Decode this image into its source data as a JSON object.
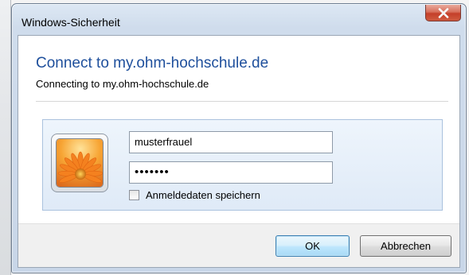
{
  "window": {
    "title": "Windows-Sicherheit",
    "close_icon": "close-x-icon"
  },
  "dialog": {
    "heading": "Connect to my.ohm-hochschule.de",
    "subheading": "Connecting to my.ohm-hochschule.de"
  },
  "credentials": {
    "user_tile_icon": "user-flower-icon",
    "username_value": "musterfrauel",
    "password_masked": "•••••••",
    "remember_label": "Anmeldedaten speichern",
    "remember_checked": false
  },
  "buttons": {
    "ok_label": "OK",
    "cancel_label": "Abbrechen"
  },
  "colors": {
    "heading": "#1e4f9c",
    "close_button": "#c4402a",
    "ok_focus": "#3c7fb1"
  }
}
